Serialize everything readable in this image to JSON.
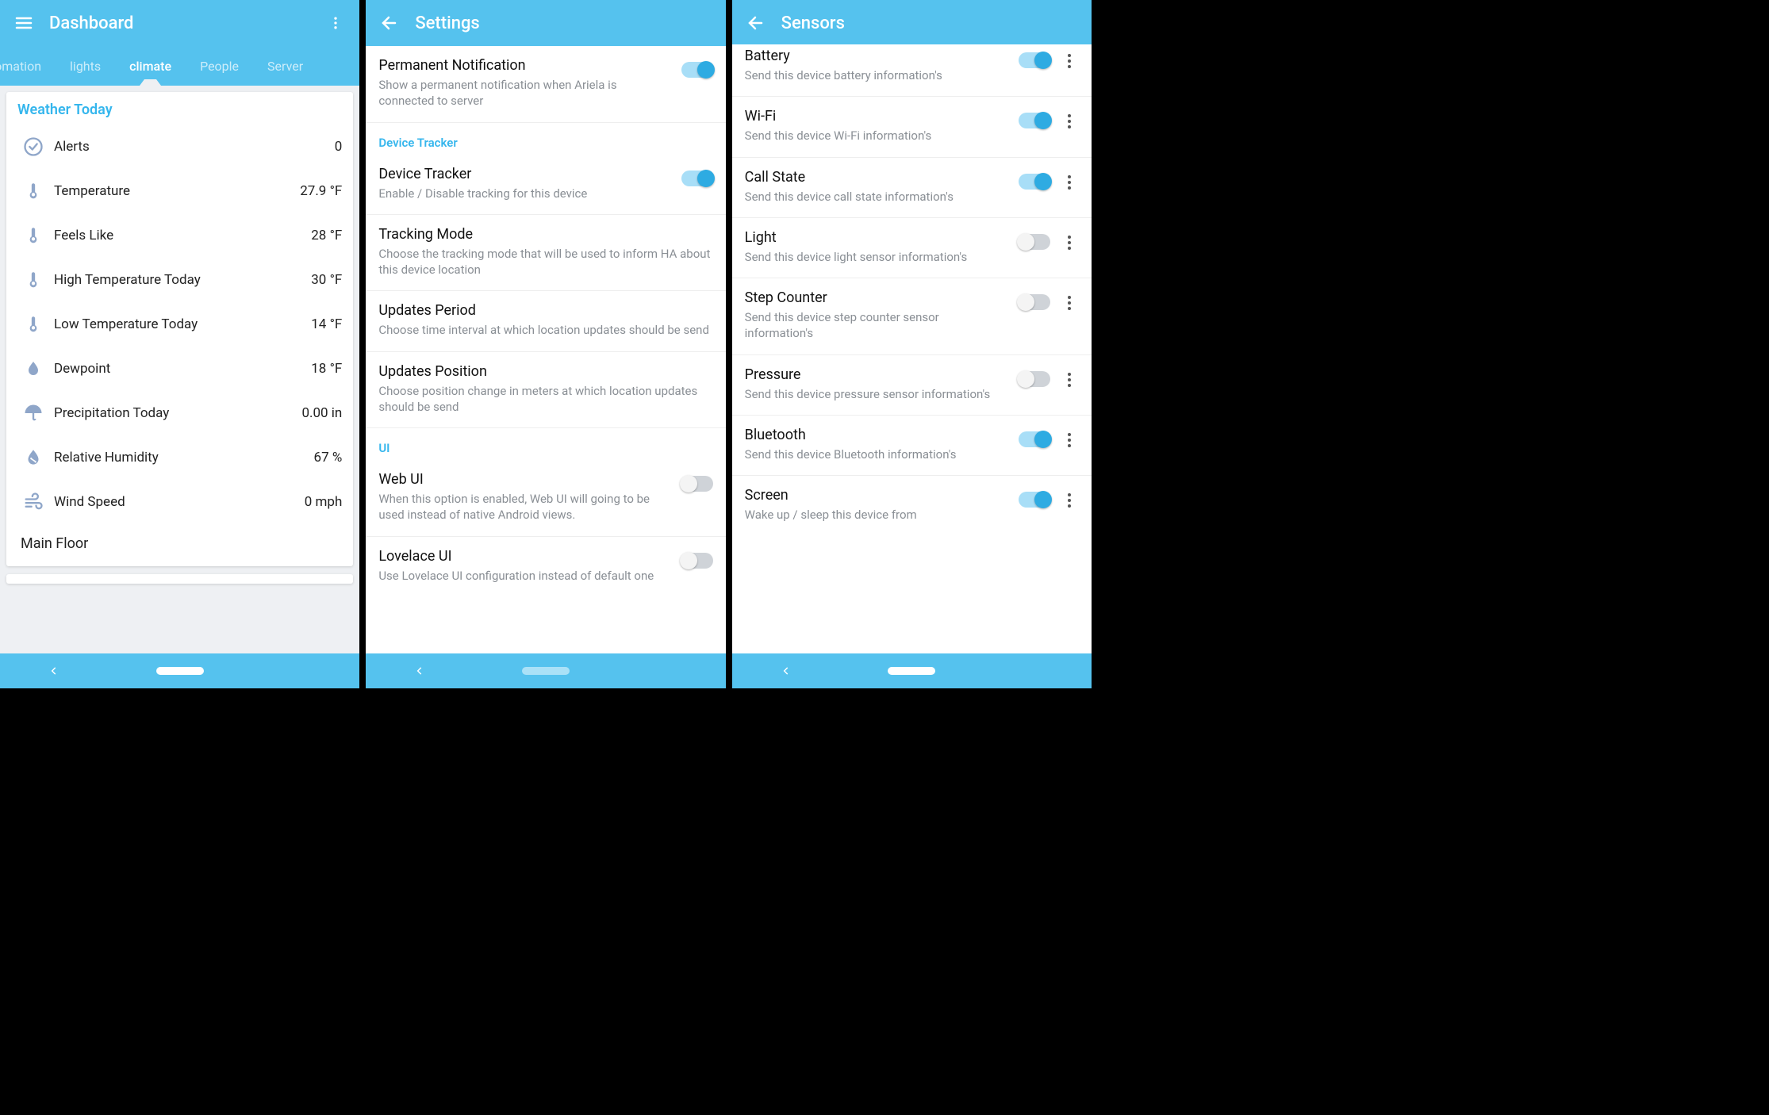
{
  "panel1": {
    "title": "Dashboard",
    "tabs": [
      "tomation",
      "lights",
      "climate",
      "People",
      "Server"
    ],
    "active_tab": "climate",
    "card_title": "Weather Today",
    "rows": [
      {
        "icon": "check-circle-icon",
        "label": "Alerts",
        "value": "0"
      },
      {
        "icon": "thermometer-icon",
        "label": "Temperature",
        "value": "27.9 °F"
      },
      {
        "icon": "thermometer-icon",
        "label": "Feels Like",
        "value": "28 °F"
      },
      {
        "icon": "thermometer-icon",
        "label": "High Temperature Today",
        "value": "30 °F"
      },
      {
        "icon": "thermometer-icon",
        "label": "Low Temperature Today",
        "value": "14 °F"
      },
      {
        "icon": "water-drop-icon",
        "label": "Dewpoint",
        "value": "18 °F"
      },
      {
        "icon": "umbrella-icon",
        "label": "Precipitation Today",
        "value": "0.00 in"
      },
      {
        "icon": "humidity-icon",
        "label": "Relative Humidity",
        "value": "67 %"
      },
      {
        "icon": "wind-icon",
        "label": "Wind Speed",
        "value": "0 mph"
      }
    ],
    "footer": "Main Floor"
  },
  "panel2": {
    "title": "Settings",
    "items": [
      {
        "title": "Permanent Notification",
        "sub": "Show a permanent notification when Ariela is connected to server",
        "toggle": "on"
      },
      {
        "header": "Device Tracker"
      },
      {
        "title": "Device Tracker",
        "sub": "Enable / Disable tracking for this device",
        "toggle": "on"
      },
      {
        "title": "Tracking Mode",
        "sub": "Choose the tracking mode that will be used to inform HA about this device location"
      },
      {
        "title": "Updates Period",
        "sub": "Choose time interval at which location updates should be send"
      },
      {
        "title": "Updates Position",
        "sub": "Choose position change in meters at which location updates should be send"
      },
      {
        "header": "UI"
      },
      {
        "title": "Web UI",
        "sub": "When this option is enabled, Web UI will going to be used instead of native Android views.",
        "toggle": "off"
      },
      {
        "title": "Lovelace UI",
        "sub": "Use Lovelace UI configuration instead of default one",
        "toggle": "off"
      }
    ]
  },
  "panel3": {
    "title": "Sensors",
    "items": [
      {
        "title": "Battery",
        "sub": "Send this device battery information's",
        "toggle": "on",
        "more": true
      },
      {
        "title": "Wi-Fi",
        "sub": "Send this device Wi-Fi information's",
        "toggle": "on",
        "more": true
      },
      {
        "title": "Call State",
        "sub": "Send this device call state information's",
        "toggle": "on",
        "more": true
      },
      {
        "title": "Light",
        "sub": "Send this device light sensor information's",
        "toggle": "off",
        "more": true
      },
      {
        "title": "Step Counter",
        "sub": "Send this device step counter sensor information's",
        "toggle": "off",
        "more": true
      },
      {
        "title": "Pressure",
        "sub": "Send this device pressure sensor information's",
        "toggle": "off",
        "more": true
      },
      {
        "title": "Bluetooth",
        "sub": "Send this device Bluetooth information's",
        "toggle": "on",
        "more": true
      },
      {
        "title": "Screen",
        "sub": "Wake up / sleep this device from",
        "toggle": "on",
        "more": true
      }
    ]
  }
}
